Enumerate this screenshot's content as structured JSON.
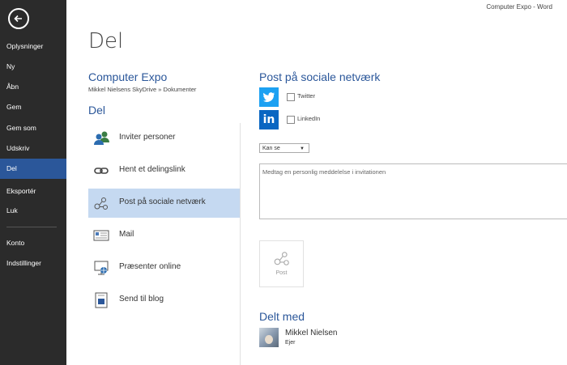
{
  "window": {
    "title": "Computer Expo - Word"
  },
  "sidebar": {
    "items": [
      {
        "label": "Oplysninger"
      },
      {
        "label": "Ny"
      },
      {
        "label": "Åbn"
      },
      {
        "label": "Gem"
      },
      {
        "label": "Gem som"
      },
      {
        "label": "Udskriv"
      },
      {
        "label": "Del",
        "active": true
      },
      {
        "label": "Eksportér"
      },
      {
        "label": "Luk"
      },
      {
        "label": "Konto"
      },
      {
        "label": "Indstillinger"
      }
    ]
  },
  "page": {
    "title": "Del",
    "document_title": "Computer Expo",
    "document_path": "Mikkel Nielsens SkyDrive » Dokumenter",
    "section_title": "Del"
  },
  "share_options": [
    {
      "label": "Inviter personer",
      "icon": "invite-people-icon"
    },
    {
      "label": "Hent et delingslink",
      "icon": "link-icon"
    },
    {
      "label": "Post på sociale netværk",
      "icon": "social-network-icon",
      "active": true
    },
    {
      "label": "Mail",
      "icon": "mail-icon"
    },
    {
      "label": "Præsenter online",
      "icon": "present-online-icon"
    },
    {
      "label": "Send til blog",
      "icon": "blog-icon"
    }
  ],
  "social": {
    "title": "Post på sociale netværk",
    "networks": [
      {
        "label": "Twitter",
        "logo": "t",
        "color": "#1da1f2"
      },
      {
        "label": "LinkedIn",
        "logo": "in",
        "color": "#0a66c2"
      }
    ],
    "permission": {
      "selected": "Kan se"
    },
    "message_placeholder": "Medtag en personlig meddelelse i invitationen",
    "post_label": "Post"
  },
  "shared_with": {
    "title": "Delt med",
    "users": [
      {
        "name": "Mikkel Nielsen",
        "role": "Ejer"
      }
    ]
  },
  "colors": {
    "accent": "#2b579a",
    "sidebar_bg": "#2b2b2b",
    "selected_bg": "#c5d9f1"
  }
}
